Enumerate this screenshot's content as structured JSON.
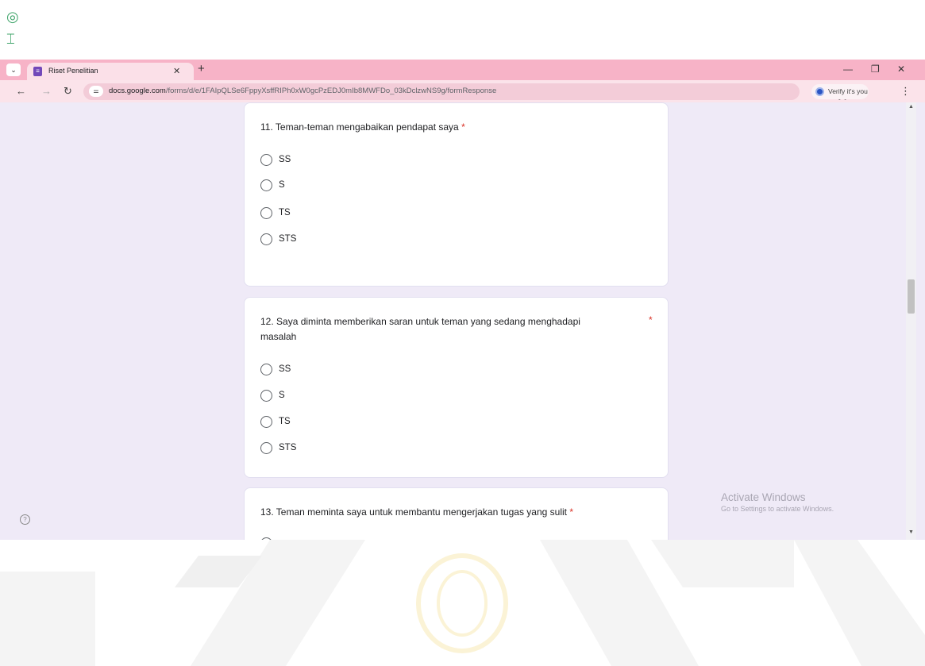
{
  "browser": {
    "tab_title": "Riset Penelitian",
    "url_host": "docs.google.com",
    "url_path": "/forms/d/e/1FAIpQLSe6FppyXsffRIPh0xW0gcPzEDJ0mIb8MWFDo_03kDclzwNS9g/formResponse",
    "profile_label": "Verify it's you"
  },
  "form": {
    "questions": [
      {
        "title": "11. Teman-teman mengabaikan pendapat saya",
        "required": "*",
        "options": [
          "SS",
          "S",
          "TS",
          "STS"
        ]
      },
      {
        "title_line1": "12. Saya diminta memberikan saran untuk teman yang sedang menghadapi",
        "title_line2": "masalah",
        "required": "*",
        "options": [
          "SS",
          "S",
          "TS",
          "STS"
        ]
      },
      {
        "title": "13. Teman meminta saya untuk membantu mengerjakan tugas yang sulit",
        "required": "*"
      }
    ]
  },
  "watermark": {
    "line1": "Activate Windows",
    "line2": "Go to Settings to activate Windows."
  },
  "colors": {
    "tabbar": "#f7b3c7",
    "form_bg": "#efeaf7",
    "required": "#d93025"
  }
}
